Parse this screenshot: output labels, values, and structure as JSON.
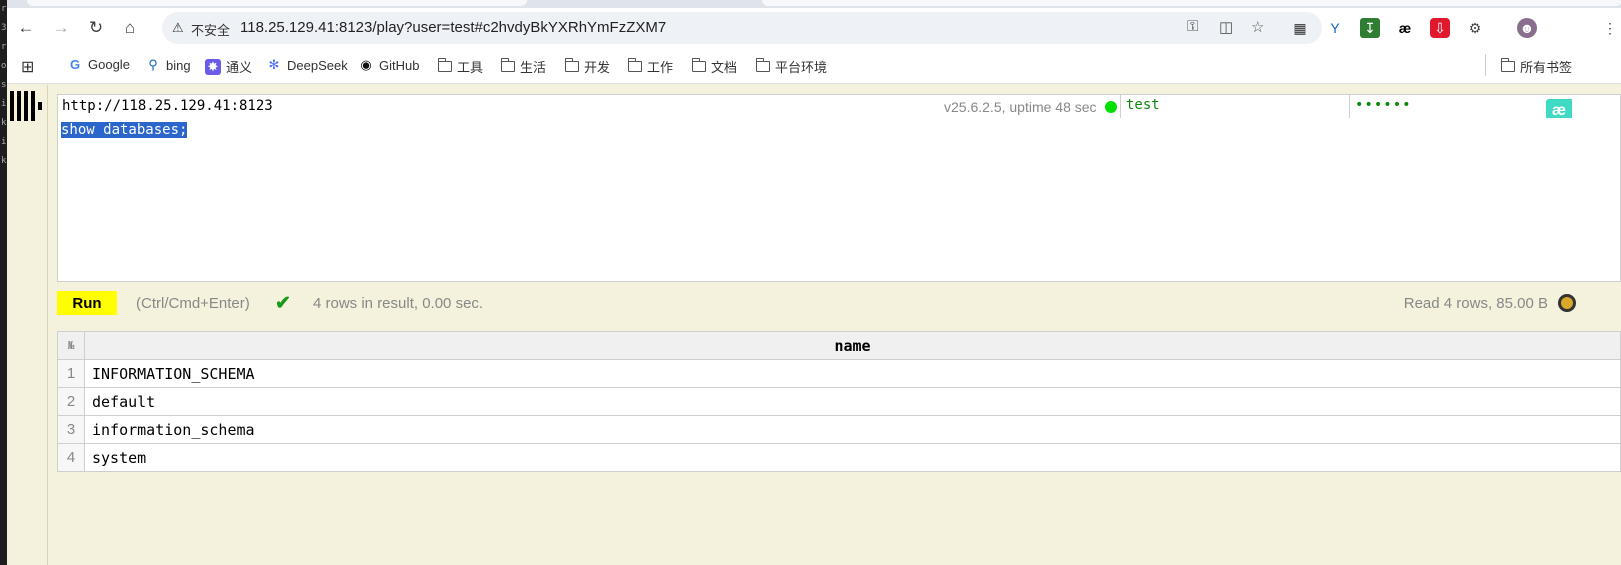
{
  "browser": {
    "insecure_label": "不安全",
    "url": "118.25.129.41:8123/play?user=test#c2hvdyBkYXRhYmFzZXM7",
    "icons": [
      "back-icon",
      "forward-icon",
      "reload-icon",
      "home-icon",
      "key-icon",
      "translate-icon",
      "star-icon"
    ]
  },
  "bookmarks": [
    {
      "label": "Google",
      "icon": "google-icon"
    },
    {
      "label": "bing",
      "icon": "search-icon"
    },
    {
      "label": "通义",
      "icon": "tongyi-icon"
    },
    {
      "label": "DeepSeek",
      "icon": "deepseek-icon"
    },
    {
      "label": "GitHub",
      "icon": "github-icon"
    },
    {
      "label": "工具",
      "icon": "folder-icon"
    },
    {
      "label": "生活",
      "icon": "folder-icon"
    },
    {
      "label": "开发",
      "icon": "folder-icon"
    },
    {
      "label": "工作",
      "icon": "folder-icon"
    },
    {
      "label": "文档",
      "icon": "folder-icon"
    },
    {
      "label": "平台环境",
      "icon": "folder-icon"
    },
    {
      "label": "所有书签",
      "icon": "folder-icon"
    }
  ],
  "connection": {
    "url": "http://118.25.129.41:8123",
    "server_info": "v25.6.2.5, uptime 48 sec",
    "status_color": "#00e000",
    "user": "test",
    "password_mask": "••••••"
  },
  "editor": {
    "query": "show databases;"
  },
  "run_bar": {
    "run_label": "Run",
    "hint": "(Ctrl/Cmd+Enter)",
    "result_message": "4 rows in result, 0.00 sec.",
    "read_stats": "Read 4 rows, 85.00 B"
  },
  "results": {
    "row_num_header": "№",
    "column": "name",
    "rows": [
      {
        "num": "1",
        "value": "INFORMATION_SCHEMA"
      },
      {
        "num": "2",
        "value": "default"
      },
      {
        "num": "3",
        "value": "information_schema"
      },
      {
        "num": "4",
        "value": "system"
      }
    ]
  },
  "colors": {
    "page_bg": "#f4f1dc",
    "run_button": "#ffff00",
    "selection": "#2a66cc",
    "accent_green": "#0a8a0a"
  }
}
